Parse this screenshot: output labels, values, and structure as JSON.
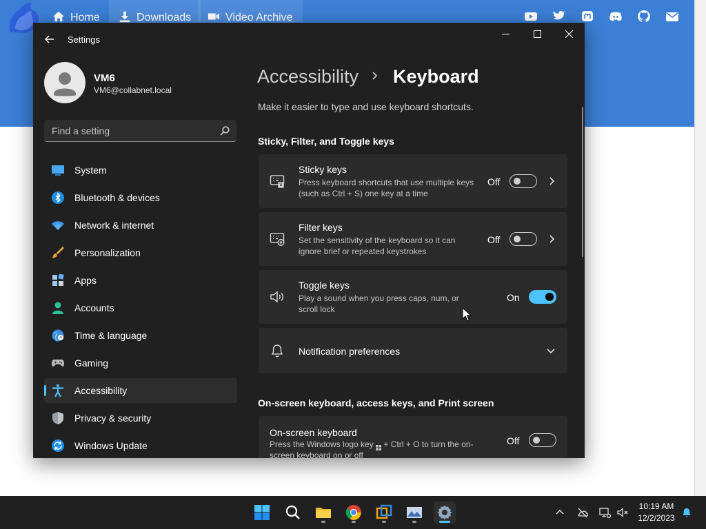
{
  "colors": {
    "accent": "#4cc2ff",
    "window_bg": "#202020",
    "card_bg": "#2b2b2b",
    "browser_header": "#3b7fd6"
  },
  "browser": {
    "nav": [
      {
        "label": "Home",
        "icon": "home-icon"
      },
      {
        "label": "Downloads",
        "icon": "download-icon"
      },
      {
        "label": "Video Archive",
        "icon": "video-icon"
      }
    ],
    "social_icons": [
      "youtube-icon",
      "twitter-icon",
      "mastodon-icon",
      "discord-icon",
      "github-icon",
      "mail-icon"
    ]
  },
  "window": {
    "title": "Settings"
  },
  "profile": {
    "name": "VM6",
    "email": "VM6@collabnet.local"
  },
  "search": {
    "placeholder": "Find a setting"
  },
  "sidebar": {
    "items": [
      {
        "label": "System",
        "icon": "system-icon",
        "selected": false
      },
      {
        "label": "Bluetooth & devices",
        "icon": "bluetooth-icon",
        "selected": false
      },
      {
        "label": "Network & internet",
        "icon": "wifi-icon",
        "selected": false
      },
      {
        "label": "Personalization",
        "icon": "brush-icon",
        "selected": false
      },
      {
        "label": "Apps",
        "icon": "apps-icon",
        "selected": false
      },
      {
        "label": "Accounts",
        "icon": "accounts-icon",
        "selected": false
      },
      {
        "label": "Time & language",
        "icon": "globe-icon",
        "selected": false
      },
      {
        "label": "Gaming",
        "icon": "gamepad-icon",
        "selected": false
      },
      {
        "label": "Accessibility",
        "icon": "accessibility-icon",
        "selected": true
      },
      {
        "label": "Privacy & security",
        "icon": "shield-icon",
        "selected": false
      },
      {
        "label": "Windows Update",
        "icon": "update-icon",
        "selected": false
      }
    ]
  },
  "main": {
    "breadcrumb_parent": "Accessibility",
    "breadcrumb_current": "Keyboard",
    "description": "Make it easier to type and use keyboard shortcuts.",
    "section1_heading": "Sticky, Filter, and Toggle keys",
    "section2_heading": "On-screen keyboard, access keys, and Print screen",
    "cards": {
      "sticky": {
        "title": "Sticky keys",
        "desc": "Press keyboard shortcuts that use multiple keys (such as Ctrl + S) one key at a time",
        "state": "Off",
        "on": false
      },
      "filter": {
        "title": "Filter keys",
        "desc": "Set the sensitivity of the keyboard so it can ignore brief or repeated keystrokes",
        "state": "Off",
        "on": false
      },
      "toggle": {
        "title": "Toggle keys",
        "desc": "Play a sound when you press caps, num, or scroll lock",
        "state": "On",
        "on": true
      },
      "notifications": {
        "title": "Notification preferences"
      },
      "osk": {
        "title": "On-screen keyboard",
        "desc_part1": "Press the Windows logo key",
        "desc_part2": "+ Ctrl + O to turn the on-screen keyboard on or off",
        "state": "Off",
        "on": false
      }
    }
  },
  "taskbar": {
    "apps": [
      "start-icon",
      "search-icon",
      "file-explorer-icon",
      "chrome-icon",
      "vmware-icon",
      "photos-icon",
      "settings-icon"
    ],
    "active_app": "settings-icon",
    "time": "10:19 AM",
    "date": "12/2/2023"
  }
}
